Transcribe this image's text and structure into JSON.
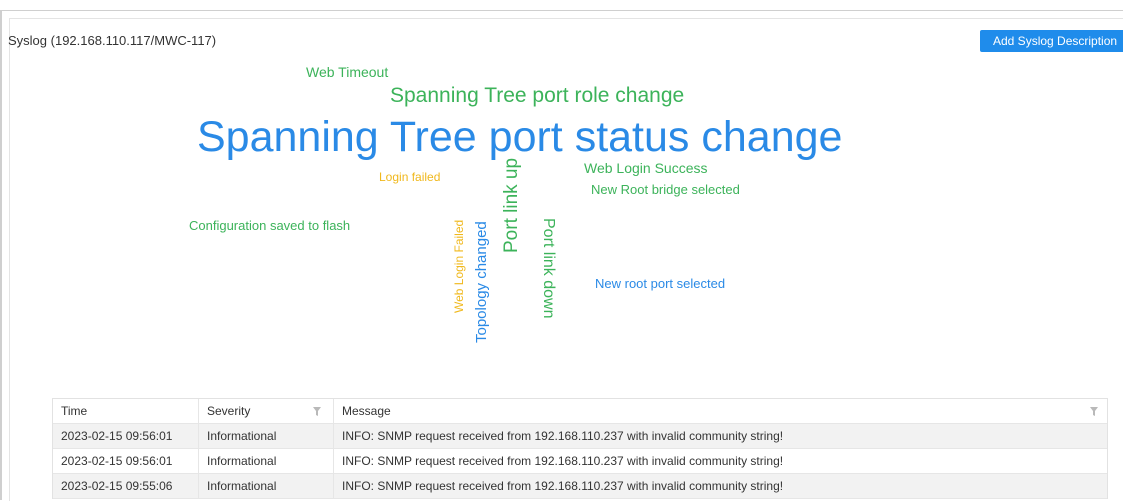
{
  "panel": {
    "title": "Syslog (192.168.110.117/MWC-117)",
    "add_button_label": "Add Syslog Description"
  },
  "word_cloud": [
    {
      "text": "Web Timeout",
      "color": "#3cb35a"
    },
    {
      "text": "Spanning Tree port role change",
      "color": "#3cb35a"
    },
    {
      "text": "Spanning Tree port status change",
      "color": "#2a8ae6"
    },
    {
      "text": "Login failed",
      "color": "#f0b81c"
    },
    {
      "text": "Web Login Success",
      "color": "#3cb35a"
    },
    {
      "text": "New Root bridge selected",
      "color": "#3cb35a"
    },
    {
      "text": "Configuration saved to flash",
      "color": "#3cb35a"
    },
    {
      "text": "Web Login Failed",
      "color": "#f0b81c"
    },
    {
      "text": "Topology changed",
      "color": "#2a8ae6"
    },
    {
      "text": "Port link up",
      "color": "#3cb35a"
    },
    {
      "text": "Port link down",
      "color": "#3cb35a"
    },
    {
      "text": "New root port selected",
      "color": "#2a8ae6"
    }
  ],
  "table": {
    "columns": [
      "Time",
      "Severity",
      "Message"
    ],
    "rows": [
      {
        "time": "2023-02-15 09:56:01",
        "severity": "Informational",
        "message": "INFO: SNMP request received from 192.168.110.237 with invalid community string!"
      },
      {
        "time": "2023-02-15 09:56:01",
        "severity": "Informational",
        "message": "INFO: SNMP request received from 192.168.110.237 with invalid community string!"
      },
      {
        "time": "2023-02-15 09:55:06",
        "severity": "Informational",
        "message": "INFO: SNMP request received from 192.168.110.237 with invalid community string!"
      }
    ]
  },
  "icons": {
    "column_filter": "filter-icon"
  }
}
